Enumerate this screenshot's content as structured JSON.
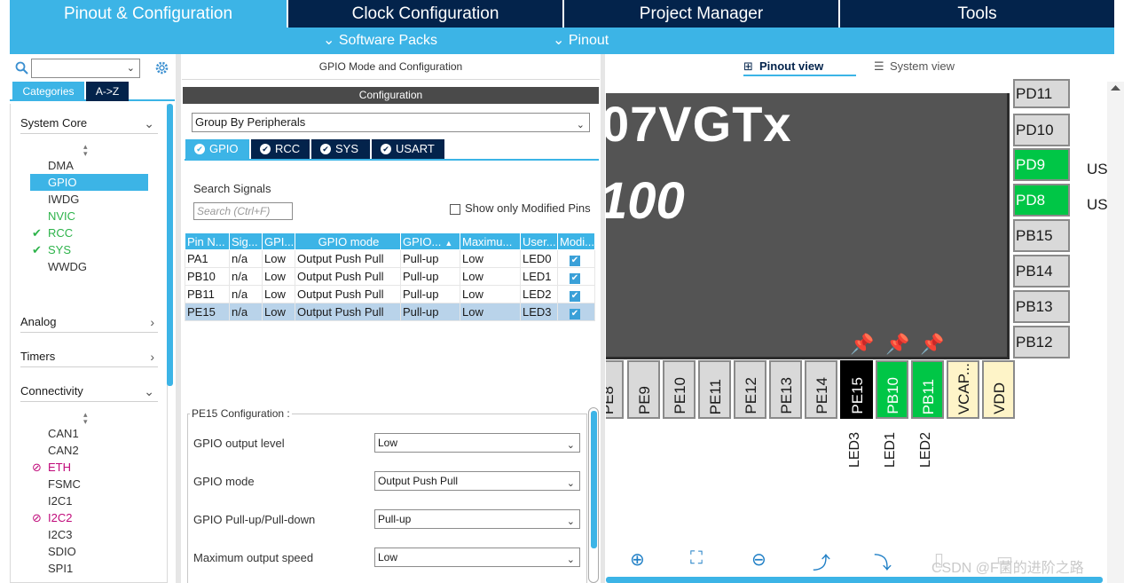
{
  "top_tabs": [
    "Pinout & Configuration",
    "Clock Configuration",
    "Project Manager",
    "Tools"
  ],
  "sub_menus": [
    "Software Packs",
    "Pinout"
  ],
  "left": {
    "search_value": "",
    "cat_tabs": [
      "Categories",
      "A->Z"
    ],
    "groups": {
      "system_core": "System Core",
      "analog": "Analog",
      "timers": "Timers",
      "connectivity": "Connectivity"
    },
    "system_core_items": [
      "DMA",
      "GPIO",
      "IWDG",
      "NVIC",
      "RCC",
      "SYS",
      "WWDG"
    ],
    "connectivity_items": [
      "CAN1",
      "CAN2",
      "ETH",
      "FSMC",
      "I2C1",
      "I2C2",
      "I2C3",
      "SDIO",
      "SPI1"
    ]
  },
  "mid": {
    "title": "GPIO Mode and Configuration",
    "config_header": "Configuration",
    "group_by": "Group By Peripherals",
    "periph_tabs": [
      "GPIO",
      "RCC",
      "SYS",
      "USART"
    ],
    "search_label": "Search Signals",
    "search_placeholder": "Search (Ctrl+F)",
    "show_modified": "Show only Modified Pins",
    "table_headers": [
      "Pin N...",
      "Sig...",
      "GPI...",
      "GPIO mode",
      "GPIO...",
      "Maximu...",
      "User...",
      "Modi..."
    ],
    "table_rows": [
      [
        "PA1",
        "n/a",
        "Low",
        "Output Push Pull",
        "Pull-up",
        "Low",
        "LED0"
      ],
      [
        "PB10",
        "n/a",
        "Low",
        "Output Push Pull",
        "Pull-up",
        "Low",
        "LED1"
      ],
      [
        "PB11",
        "n/a",
        "Low",
        "Output Push Pull",
        "Pull-up",
        "Low",
        "LED2"
      ],
      [
        "PE15",
        "n/a",
        "Low",
        "Output Push Pull",
        "Pull-up",
        "Low",
        "LED3"
      ]
    ],
    "pe15_title": "PE15 Configuration :",
    "cfg": [
      {
        "label": "GPIO output level",
        "value": "Low"
      },
      {
        "label": "GPIO mode",
        "value": "Output Push Pull"
      },
      {
        "label": "GPIO Pull-up/Pull-down",
        "value": "Pull-up"
      },
      {
        "label": "Maximum output speed",
        "value": "Low"
      }
    ]
  },
  "right": {
    "view_tabs": [
      "Pinout view",
      "System view"
    ],
    "chip_name": "07VGTx",
    "chip_pkg": "100",
    "right_pins": [
      "PD11",
      "PD10",
      "PD9",
      "PD8",
      "PB15",
      "PB14",
      "PB13",
      "PB12"
    ],
    "right_labels": [
      "US",
      "US"
    ],
    "bottom_pins": [
      "PE8",
      "PE9",
      "PE10",
      "PE11",
      "PE12",
      "PE13",
      "PE14",
      "PE15",
      "PB10",
      "PB11",
      "VCAP...",
      "VDD"
    ],
    "bottom_labels": [
      "LED3",
      "LED1",
      "LED2"
    ],
    "watermark": "CSDN @F菌的进阶之路"
  },
  "colors": {
    "accent": "#3cb4e6",
    "navy": "#03234b",
    "pin_green": "#00c646",
    "chip_gray": "#545454"
  }
}
